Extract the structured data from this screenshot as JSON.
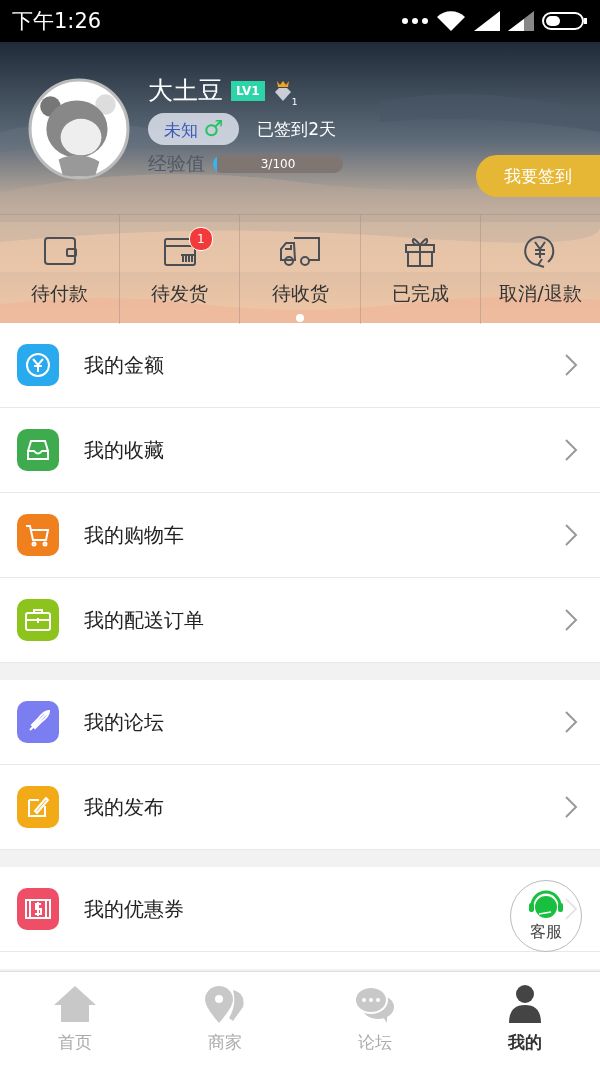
{
  "status_bar": {
    "time": "下午1:26"
  },
  "profile": {
    "name": "大土豆",
    "level_badge": "LV1",
    "vip_count": "1",
    "gender_label": "未知",
    "gender_symbol": "♂",
    "checkin_days": "已签到2天",
    "exp_label": "经验值",
    "exp": {
      "level": 0.03,
      "reading": "3/100"
    },
    "checkin_button": "我要签到"
  },
  "order_tabs": [
    {
      "label": "待付款"
    },
    {
      "label": "待发货",
      "badge": "1"
    },
    {
      "label": "待收货"
    },
    {
      "label": "已完成"
    },
    {
      "label": "取消/退款"
    }
  ],
  "menu_groups": [
    [
      {
        "label": "我的金额",
        "color": "#29a9ee"
      },
      {
        "label": "我的收藏",
        "color": "#3eab4f"
      },
      {
        "label": "我的购物车",
        "color": "#f07f1e"
      },
      {
        "label": "我的配送订单",
        "color": "#8cc31d"
      }
    ],
    [
      {
        "label": "我的论坛",
        "color": "#7a7ef0"
      },
      {
        "label": "我的发布",
        "color": "#f2aa17"
      }
    ],
    [
      {
        "label": "我的优惠券",
        "color": "#ee4f67"
      }
    ]
  ],
  "service_button": {
    "label": "客服"
  },
  "tab_bar": [
    {
      "label": "首页",
      "selected": false
    },
    {
      "label": "商家",
      "selected": false
    },
    {
      "label": "论坛",
      "selected": false
    },
    {
      "label": "我的",
      "selected": true
    }
  ]
}
